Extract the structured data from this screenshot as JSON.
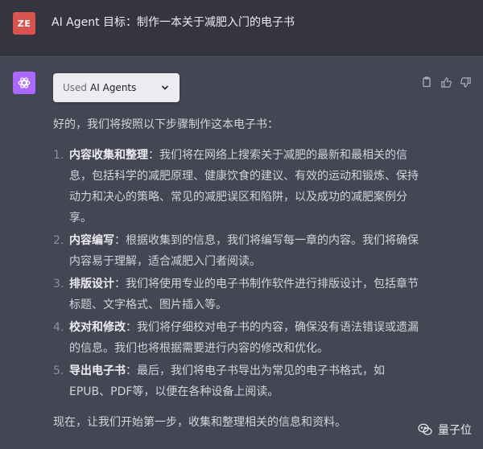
{
  "user": {
    "avatar_initials": "ZE",
    "message": "AI Agent 目标：制作一本关于减肥入门的电子书"
  },
  "assistant": {
    "plugin_pill": {
      "used_label": "Used",
      "agents_label": "AI Agents"
    },
    "intro": "好的，我们将按照以下步骤制作这本电子书：",
    "steps": [
      {
        "number": "1.",
        "title": "内容收集和整理",
        "text": "：我们将在网络上搜索关于减肥的最新和最相关的信息，包括科学的减肥原理、健康饮食的建议、有效的运动和锻炼、保持动力和决心的策略、常见的减肥误区和陷阱，以及成功的减肥案例分享。"
      },
      {
        "number": "2.",
        "title": "内容编写",
        "text": "：根据收集到的信息，我们将编写每一章的内容。我们将确保内容易于理解，适合减肥入门者阅读。"
      },
      {
        "number": "3.",
        "title": "排版设计",
        "text": "：我们将使用专业的电子书制作软件进行排版设计，包括章节标题、文字格式、图片插入等。"
      },
      {
        "number": "4.",
        "title": "校对和修改",
        "text": "：我们将仔细校对电子书的内容，确保没有语法错误或遗漏的信息。我们也将根据需要进行内容的修改和优化。"
      },
      {
        "number": "5.",
        "title": "导出电子书",
        "text": "：最后，我们将电子书导出为常见的电子书格式，如EPUB、PDF等，以便在各种设备上阅读。"
      }
    ],
    "outro": "现在，让我们开始第一步，收集和整理相关的信息和资料。"
  },
  "watermark": {
    "text": "量子位"
  },
  "colors": {
    "page_background": "#444654",
    "user_row_background": "#343541",
    "user_avatar": "#d9534f",
    "assistant_avatar": "#ab68ff",
    "pill_background": "#ececf1"
  }
}
